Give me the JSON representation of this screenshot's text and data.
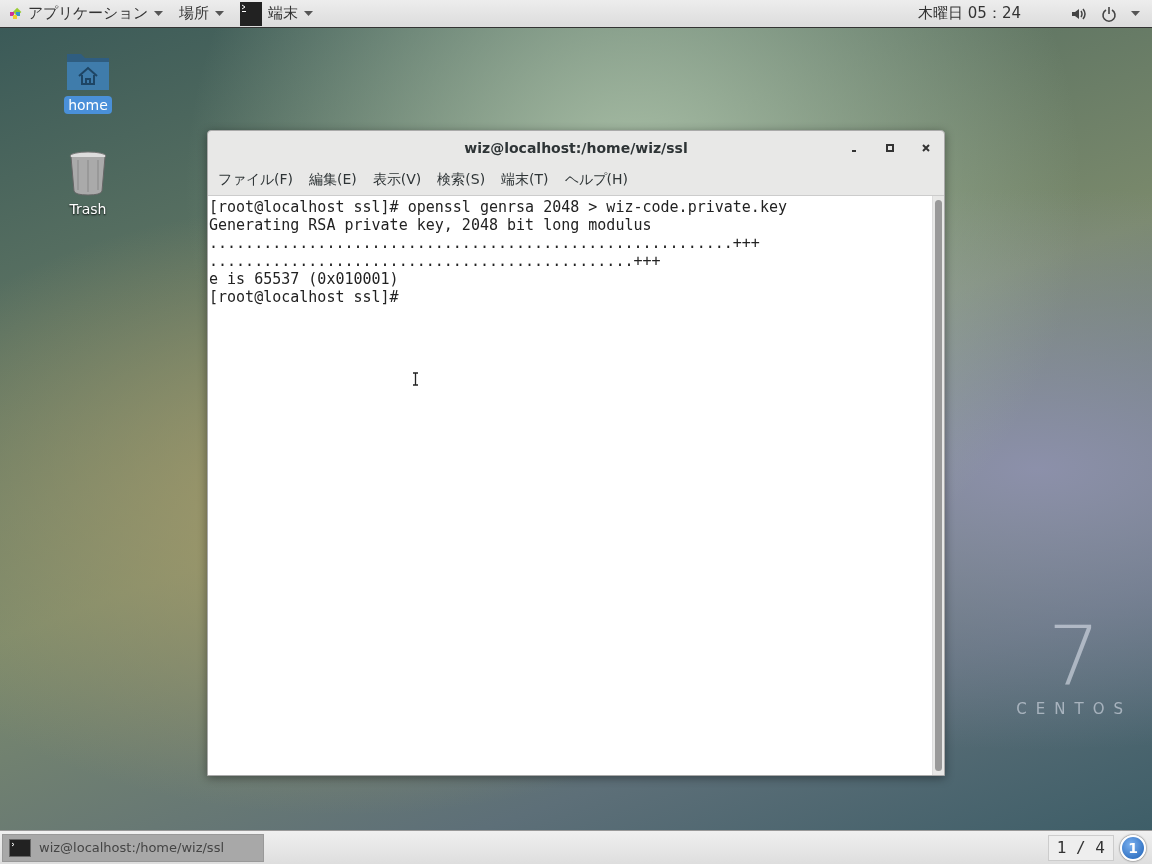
{
  "top_bar": {
    "applications_menu": "アプリケーション",
    "places_menu": "場所",
    "active_app": "端末",
    "clock": "木曜日 05：24"
  },
  "desktop_icons": [
    {
      "label": "home",
      "kind": "folder",
      "selected": true
    },
    {
      "label": "Trash",
      "kind": "trash",
      "selected": false
    }
  ],
  "window": {
    "title": "wiz@localhost:/home/wiz/ssl",
    "menu": [
      "ファイル(F)",
      "編集(E)",
      "表示(V)",
      "検索(S)",
      "端末(T)",
      "ヘルプ(H)"
    ],
    "terminal_lines": [
      "[root@localhost ssl]# openssl genrsa 2048 > wiz-code.private.key",
      "Generating RSA private key, 2048 bit long modulus",
      "..........................................................+++",
      "...............................................+++",
      "e is 65537 (0x010001)",
      "[root@localhost ssl]#"
    ]
  },
  "wallpaper_logo": {
    "number": "7",
    "name": "CENTOS"
  },
  "taskbar": {
    "tasks": [
      {
        "title": "wiz@localhost:/home/wiz/ssl",
        "selected": true
      }
    ],
    "workspace": "1 / 4",
    "notification_count": "1"
  }
}
